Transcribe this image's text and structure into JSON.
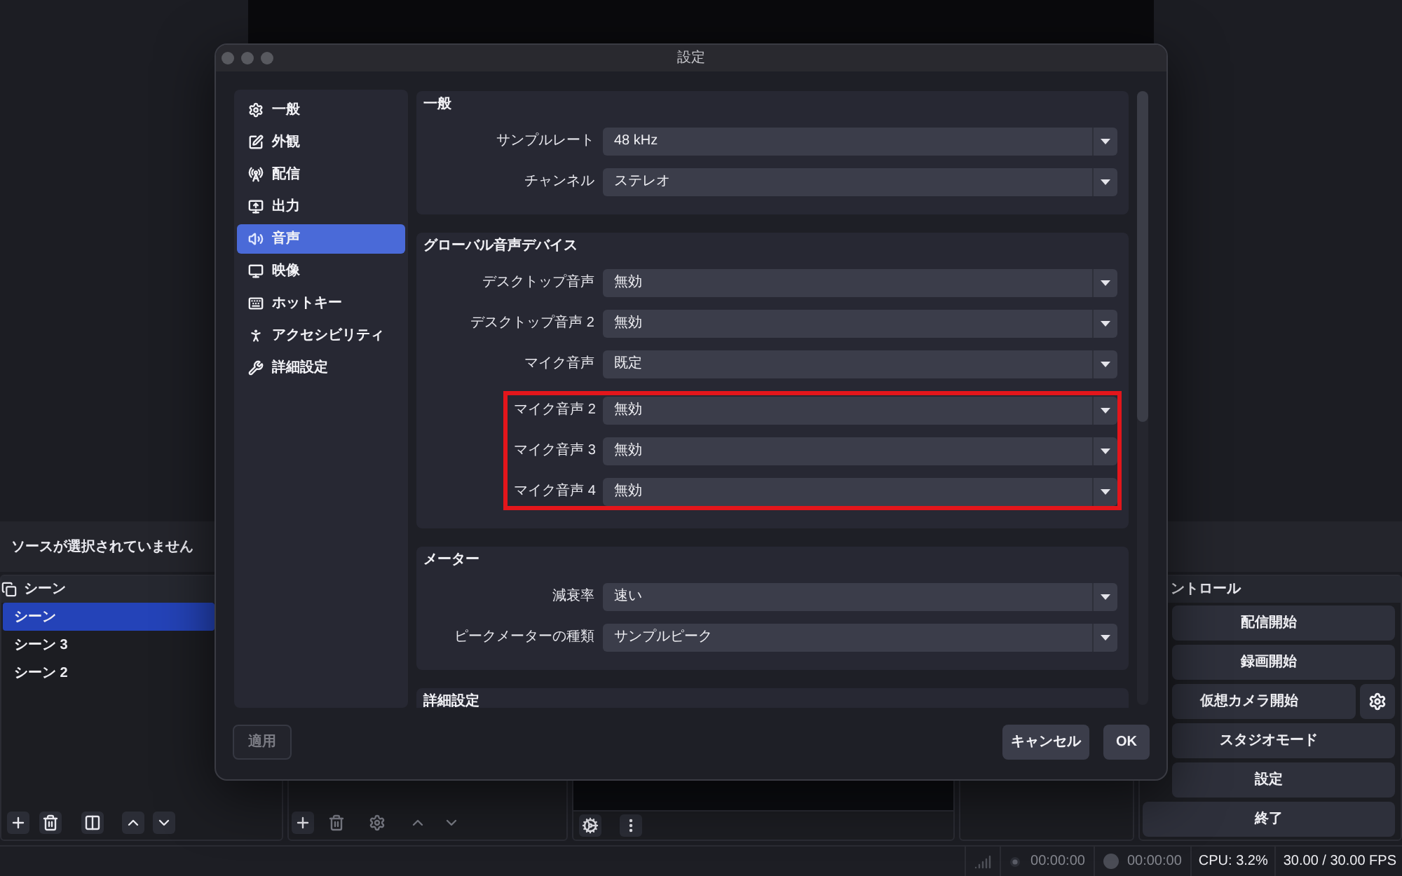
{
  "main_window": {
    "context_bar": "ソースが選択されていません",
    "scenes": {
      "title": "シーン",
      "items": [
        {
          "label": "シーン",
          "selected": true
        },
        {
          "label": "シーン 3",
          "selected": false
        },
        {
          "label": "シーン 2",
          "selected": false
        }
      ]
    },
    "controls": {
      "title": "ントロール",
      "buttons": [
        {
          "label": "配信開始",
          "settings_button": false
        },
        {
          "label": "録画開始",
          "settings_button": false
        },
        {
          "label": "仮想カメラ開始",
          "settings_button": true
        },
        {
          "label": "スタジオモード",
          "settings_button": false
        },
        {
          "label": "設定",
          "settings_button": false
        },
        {
          "label": "終了",
          "settings_button": false
        }
      ]
    },
    "status_bar": {
      "timers": [
        "00:00:00",
        "00:00:00"
      ],
      "cpu": "CPU: 3.2%",
      "fps": "30.00 / 30.00 FPS"
    }
  },
  "settings_dialog": {
    "title": "設定",
    "sidebar": {
      "items": [
        {
          "label": "一般",
          "selected": false
        },
        {
          "label": "外観",
          "selected": false
        },
        {
          "label": "配信",
          "selected": false
        },
        {
          "label": "出力",
          "selected": false
        },
        {
          "label": "音声",
          "selected": true
        },
        {
          "label": "映像",
          "selected": false
        },
        {
          "label": "ホットキー",
          "selected": false
        },
        {
          "label": "アクセシビリティ",
          "selected": false
        },
        {
          "label": "詳細設定",
          "selected": false
        }
      ]
    },
    "sections": [
      {
        "title": "一般",
        "rows": [
          {
            "label": "サンプルレート",
            "value": "48 kHz",
            "highlighted": false
          },
          {
            "label": "チャンネル",
            "value": "ステレオ",
            "highlighted": false
          }
        ]
      },
      {
        "title": "グローバル音声デバイス",
        "rows": [
          {
            "label": "デスクトップ音声",
            "value": "無効",
            "highlighted": false
          },
          {
            "label": "デスクトップ音声 2",
            "value": "無効",
            "highlighted": false
          },
          {
            "label": "マイク音声",
            "value": "既定",
            "highlighted": false
          },
          {
            "label": "マイク音声 2",
            "value": "無効",
            "highlighted": true
          },
          {
            "label": "マイク音声 3",
            "value": "無効",
            "highlighted": true
          },
          {
            "label": "マイク音声 4",
            "value": "無効",
            "highlighted": true
          }
        ]
      },
      {
        "title": "メーター",
        "rows": [
          {
            "label": "減衰率",
            "value": "速い",
            "highlighted": false
          },
          {
            "label": "ピークメーターの種類",
            "value": "サンプルピーク",
            "highlighted": false
          }
        ]
      },
      {
        "title": "詳細設定"
      }
    ],
    "buttons": [
      {
        "label": "適用",
        "disabled": true
      },
      {
        "label": "キャンセル",
        "disabled": false
      },
      {
        "label": "OK",
        "disabled": false
      }
    ]
  }
}
